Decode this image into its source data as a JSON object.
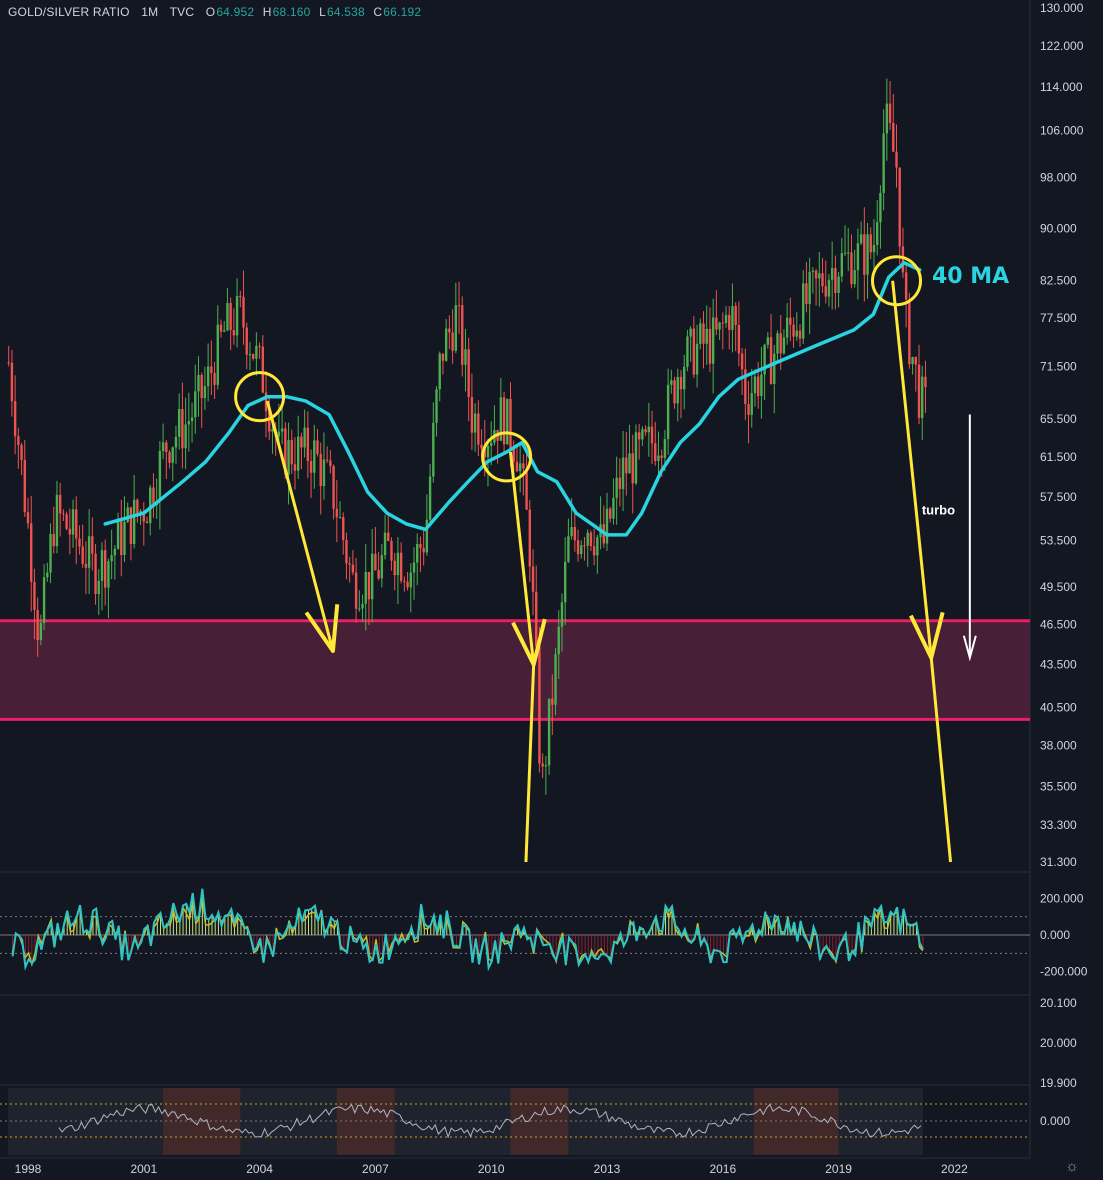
{
  "header": {
    "symbol": "GOLD/SILVER RATIO",
    "interval": "1M",
    "source": "TVC",
    "open_key": "O",
    "open_val": "64.952",
    "high_key": "H",
    "high_val": "68.160",
    "low_key": "L",
    "low_val": "64.538",
    "close_key": "C",
    "close_val": "66.192"
  },
  "colors": {
    "background": "#131722",
    "up_candle": "#26a69a",
    "down_candle": "#ef5350",
    "green_bar": "#4caf50",
    "ma_line": "#29d3e0",
    "annotation": "#ffe838",
    "support_zone": "#4a2038",
    "support_border": "#e91e63",
    "text": "#d1d4dc",
    "white": "#ffffff"
  },
  "annotations": {
    "ma_label": "40 MA",
    "turbo_label": "turbo"
  },
  "icons": {
    "settings": "gear-icon"
  },
  "chart_data": [
    {
      "type": "candlestick",
      "title": "GOLD/SILVER RATIO",
      "interval": "1M",
      "scale": "log",
      "ylim": [
        31.3,
        130.0
      ],
      "x_ticks": [
        "1998",
        "2001",
        "2004",
        "2007",
        "2010",
        "2013",
        "2016",
        "2019",
        "2022"
      ],
      "y_ticks": [
        "130.000",
        "122.000",
        "114.000",
        "106.000",
        "98.000",
        "90.000",
        "82.500",
        "77.500",
        "71.500",
        "65.500",
        "61.500",
        "57.500",
        "53.500",
        "49.500",
        "46.500",
        "43.500",
        "40.500",
        "38.000",
        "35.500",
        "33.300",
        "31.300"
      ],
      "ohlc_last": {
        "open": 64.952,
        "high": 68.16,
        "low": 64.538,
        "close": 66.192
      },
      "support_zone": [
        39.7,
        46.8
      ],
      "price_path": [
        [
          1997.5,
          72
        ],
        [
          1997.9,
          58
        ],
        [
          1998.3,
          45
        ],
        [
          1998.7,
          56
        ],
        [
          1999.2,
          54
        ],
        [
          1999.7,
          51
        ],
        [
          2000.1,
          52
        ],
        [
          2000.6,
          55
        ],
        [
          2001.1,
          57
        ],
        [
          2001.6,
          63
        ],
        [
          2002.1,
          65
        ],
        [
          2002.6,
          69
        ],
        [
          2003.1,
          76
        ],
        [
          2003.5,
          78
        ],
        [
          2004.1,
          70
        ],
        [
          2004.5,
          62
        ],
        [
          2004.9,
          62
        ],
        [
          2005.4,
          62
        ],
        [
          2005.9,
          58
        ],
        [
          2006.4,
          50
        ],
        [
          2006.9,
          50
        ],
        [
          2007.4,
          53
        ],
        [
          2007.9,
          51
        ],
        [
          2008.3,
          54
        ],
        [
          2008.7,
          73
        ],
        [
          2009.1,
          78
        ],
        [
          2009.5,
          66
        ],
        [
          2009.9,
          64
        ],
        [
          2010.3,
          66
        ],
        [
          2010.7,
          62
        ],
        [
          2011.0,
          53
        ],
        [
          2011.3,
          35
        ],
        [
          2011.7,
          44
        ],
        [
          2012.0,
          53
        ],
        [
          2012.5,
          55
        ],
        [
          2012.9,
          53
        ],
        [
          2013.4,
          60
        ],
        [
          2013.9,
          62
        ],
        [
          2014.4,
          64
        ],
        [
          2014.9,
          72
        ],
        [
          2015.4,
          74
        ],
        [
          2015.9,
          75
        ],
        [
          2016.2,
          79
        ],
        [
          2016.6,
          68
        ],
        [
          2016.9,
          70
        ],
        [
          2017.3,
          73
        ],
        [
          2017.7,
          76
        ],
        [
          2018.1,
          79
        ],
        [
          2018.6,
          83
        ],
        [
          2019.0,
          85
        ],
        [
          2019.5,
          86
        ],
        [
          2019.9,
          87
        ],
        [
          2020.2,
          108
        ],
        [
          2020.5,
          100
        ],
        [
          2020.7,
          78
        ],
        [
          2020.9,
          73
        ],
        [
          2021.1,
          68
        ],
        [
          2021.3,
          66.19
        ]
      ],
      "ma40": [
        [
          2000.0,
          55
        ],
        [
          2001.0,
          56
        ],
        [
          2002.0,
          59
        ],
        [
          2002.6,
          61
        ],
        [
          2003.2,
          64
        ],
        [
          2003.7,
          67
        ],
        [
          2004.2,
          68
        ],
        [
          2004.7,
          68
        ],
        [
          2005.2,
          67.5
        ],
        [
          2005.8,
          66
        ],
        [
          2006.3,
          62
        ],
        [
          2006.8,
          58
        ],
        [
          2007.3,
          56
        ],
        [
          2007.8,
          55
        ],
        [
          2008.3,
          54.5
        ],
        [
          2008.9,
          57
        ],
        [
          2009.4,
          59
        ],
        [
          2009.9,
          61
        ],
        [
          2010.4,
          62
        ],
        [
          2010.8,
          63
        ],
        [
          2011.2,
          60
        ],
        [
          2011.7,
          59
        ],
        [
          2012.2,
          56
        ],
        [
          2012.6,
          55
        ],
        [
          2013.0,
          54
        ],
        [
          2013.5,
          54
        ],
        [
          2013.9,
          56
        ],
        [
          2014.4,
          60
        ],
        [
          2014.9,
          63
        ],
        [
          2015.4,
          65
        ],
        [
          2015.9,
          68
        ],
        [
          2016.4,
          70
        ],
        [
          2016.9,
          71
        ],
        [
          2017.4,
          72
        ],
        [
          2017.9,
          73
        ],
        [
          2018.4,
          74
        ],
        [
          2018.9,
          75
        ],
        [
          2019.4,
          76
        ],
        [
          2019.9,
          78
        ],
        [
          2020.3,
          83
        ],
        [
          2020.7,
          85
        ],
        [
          2021.1,
          84
        ]
      ],
      "yellow_arrows": [
        {
          "from": [
            2004.2,
            67.5
          ],
          "to": [
            2005.9,
            44.5
          ]
        },
        {
          "from": [
            2010.5,
            62.0
          ],
          "to": [
            2011.1,
            43.5
          ]
        },
        {
          "from": [
            2011.1,
            43.5
          ],
          "to": [
            2010.9,
            31.3
          ]
        },
        {
          "from": [
            2020.4,
            82.5
          ],
          "to": [
            2021.4,
            44.0
          ]
        },
        {
          "from": [
            2021.4,
            44.0
          ],
          "to": [
            2021.9,
            31.3
          ]
        }
      ],
      "yellow_circles": [
        [
          2004.0,
          68.0
        ],
        [
          2010.4,
          61.5
        ],
        [
          2020.5,
          82.5
        ]
      ],
      "white_arrow": {
        "from": [
          2022.4,
          66.0
        ],
        "to": [
          2022.4,
          44.0
        ]
      }
    },
    {
      "type": "line",
      "title": "",
      "ylim": [
        -300,
        300
      ],
      "y_ticks": [
        "200.000",
        "0.000",
        "-200.000"
      ],
      "guide_levels": [
        100,
        -100
      ]
    },
    {
      "type": "line",
      "title": "",
      "y_ticks": [
        "20.100",
        "20.000",
        "19.900"
      ]
    },
    {
      "type": "line",
      "title": "",
      "y_ticks": [
        "0.000"
      ]
    }
  ]
}
